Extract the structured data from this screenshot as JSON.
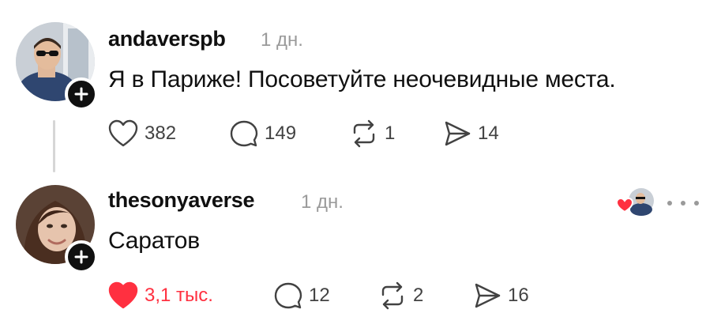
{
  "posts": [
    {
      "username": "andaverspb",
      "time": "1 дн.",
      "text": "Я в Париже! Посоветуйте неочевидные места.",
      "likes": "382",
      "comments": "149",
      "reposts": "1",
      "shares": "14",
      "liked": false
    },
    {
      "username": "thesonyaverse",
      "time": "1 дн.",
      "text": "Саратов",
      "likes": "3,1 тыс.",
      "comments": "12",
      "reposts": "2",
      "shares": "16",
      "liked": true
    }
  ],
  "icons": {
    "like": "heart-icon",
    "comment": "comment-bubble-icon",
    "repost": "repost-icon",
    "share": "send-icon",
    "follow": "plus-icon",
    "more": "more-dots-icon"
  },
  "colors": {
    "liked_red": "#ff3040",
    "muted_text": "#9a9a9a",
    "count_text": "#424242",
    "badge": "#101010"
  }
}
